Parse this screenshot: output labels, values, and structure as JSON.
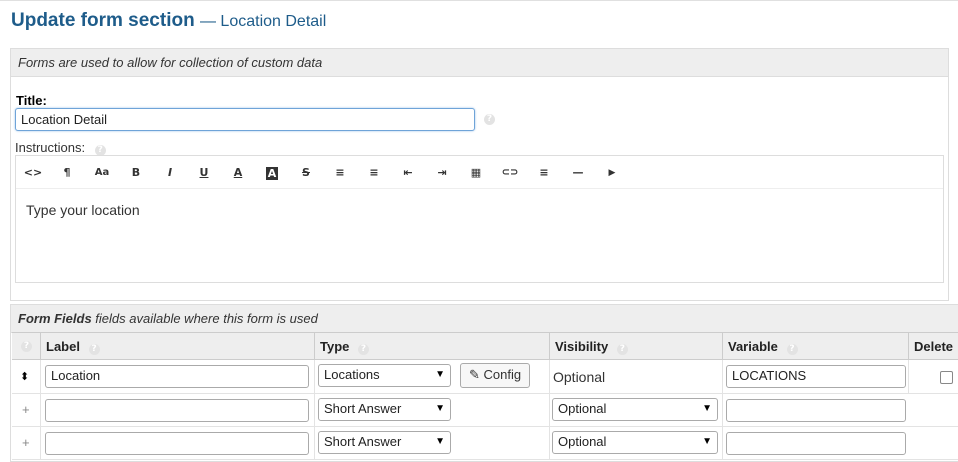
{
  "page": {
    "title": "Update form section",
    "subtitle": "— Location Detail"
  },
  "section_panel": {
    "description": "Forms are used to allow for collection of custom data",
    "title_label": "Title:",
    "title_value": "Location Detail",
    "instructions_label": "Instructions:",
    "instructions_text": "Type your location"
  },
  "toolbar": {
    "code": "<>",
    "paragraph": "¶",
    "font_size": "Aa",
    "bold": "B",
    "italic": "I",
    "underline": "U",
    "font_color": "A",
    "highlight": "A",
    "strike": "S",
    "bullet_list": "≡",
    "numbered_list": "≡",
    "outdent": "⇤",
    "indent": "⇥",
    "table": "▦",
    "link": "⊂⊃",
    "align": "≡",
    "hr": "—",
    "video": "▶"
  },
  "form_fields": {
    "heading_bold": "Form Fields",
    "heading_rest": " fields available where this form is used",
    "columns": {
      "label": "Label",
      "type": "Type",
      "visibility": "Visibility",
      "variable": "Variable",
      "delete": "Delete"
    },
    "rows": [
      {
        "label": "Location",
        "type": "Locations",
        "config": "Config",
        "visibility": "Optional",
        "variable": "LOCATIONS"
      },
      {
        "label": "",
        "type": "Short Answer",
        "visibility": "Optional",
        "variable": ""
      },
      {
        "label": "",
        "type": "Short Answer",
        "visibility": "Optional",
        "variable": ""
      }
    ]
  },
  "icons": {
    "help": "?",
    "drag": "⬍",
    "add": "+",
    "dropdown": "▼",
    "edit": "✎"
  },
  "colors": {
    "title": "#1e5c8a",
    "header_bg": "#eeeeee",
    "focus_border": "#6fa4d8"
  }
}
